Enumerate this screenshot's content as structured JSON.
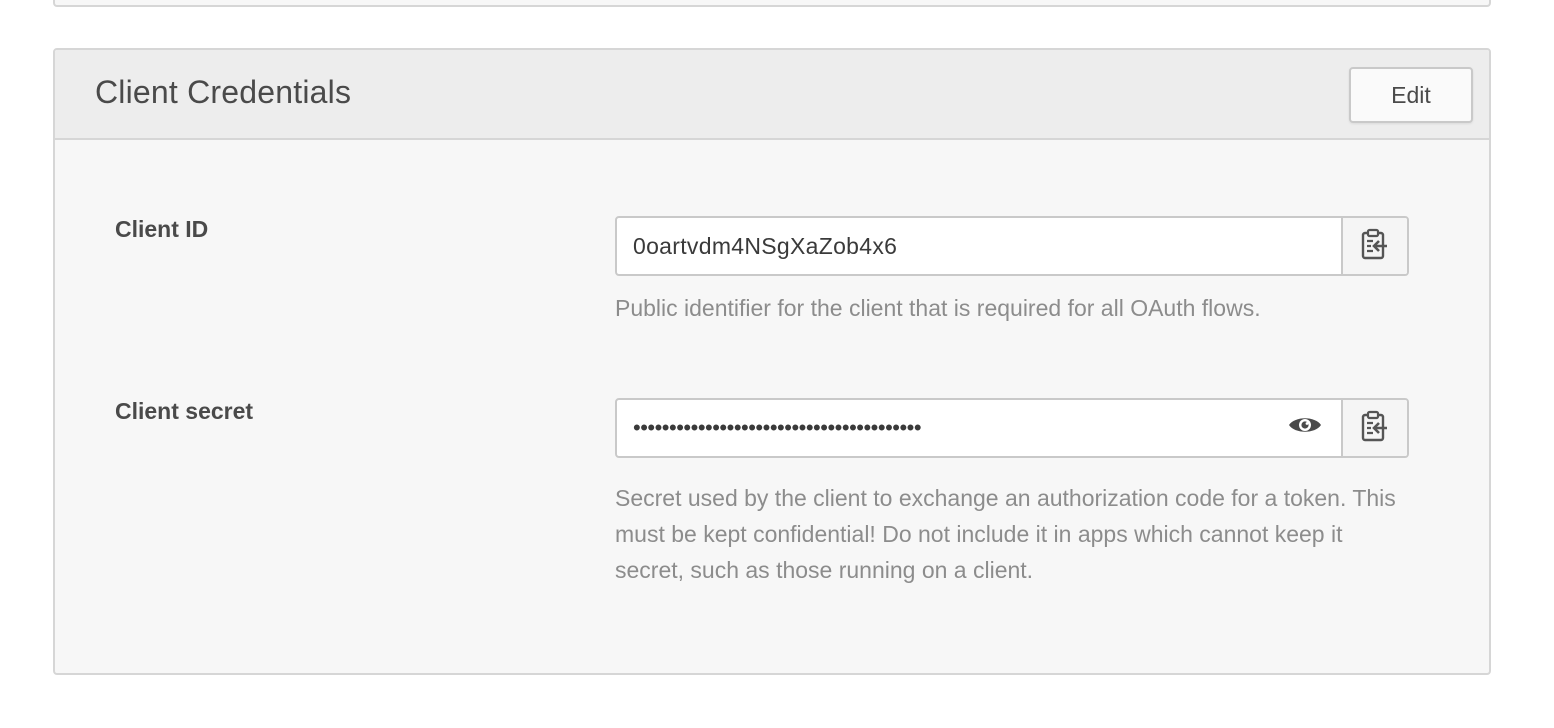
{
  "panel": {
    "title": "Client Credentials",
    "edit_label": "Edit"
  },
  "fields": {
    "client_id": {
      "label": "Client ID",
      "value": "0oartvdm4NSgXaZob4x6",
      "help": "Public identifier for the client that is required for all OAuth flows."
    },
    "client_secret": {
      "label": "Client secret",
      "masked_value": "••••••••••••••••••••••••••••••••••••••••",
      "help": "Secret used by the client to exchange an authorization code for a token. This must be kept confidential! Do not include it in apps which cannot keep it secret, such as those running on a client."
    }
  },
  "icons": {
    "copy": "clipboard-copy-icon",
    "reveal": "eye-icon"
  },
  "colors": {
    "panel_background": "#f7f7f7",
    "header_background": "#ededed",
    "border": "#d6d6d6",
    "help_text": "#8c8c8c",
    "label_text": "#4a4a4a"
  }
}
